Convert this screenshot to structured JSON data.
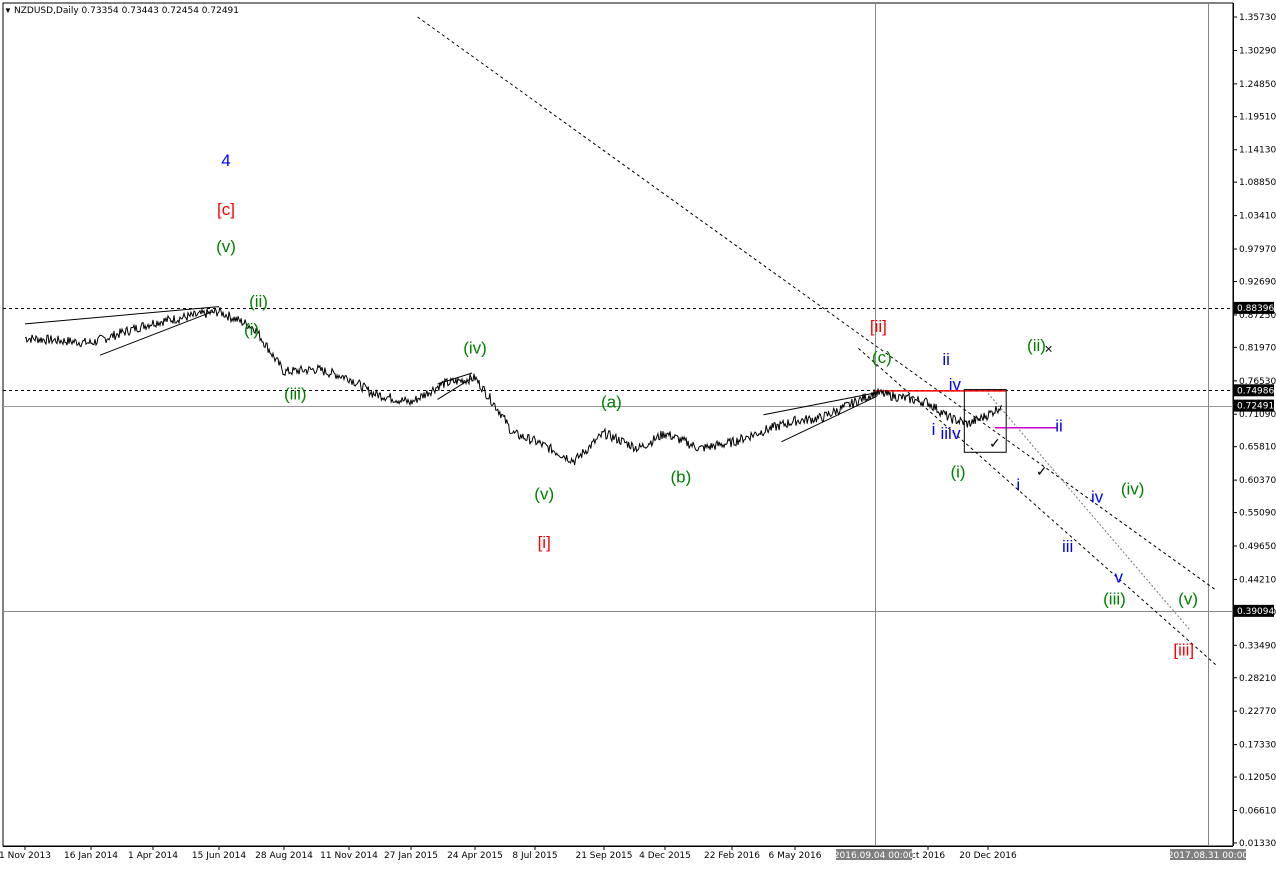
{
  "chart_data": {
    "type": "line",
    "instrument": "NZDUSD,Daily",
    "ohlc": "0.73354 0.73443 0.72454 0.72491",
    "header_text": "NZDUSD,Daily  0.73354 0.73443 0.72454 0.72491",
    "ylim": [
      0.0132,
      1.3573
    ],
    "y_ticks": [
      "1.35730",
      "1.30290",
      "1.24850",
      "1.19510",
      "1.14130",
      "1.08850",
      "1.03410",
      "0.97970",
      "0.92690",
      "0.87250",
      "0.81970",
      "0.76530",
      "0.71090",
      "0.65810",
      "0.60370",
      "0.55090",
      "0.49650",
      "0.44210",
      "0.38930",
      "0.33490",
      "0.28210",
      "0.22770",
      "0.17330",
      "0.12050",
      "0.06610",
      "0.01330"
    ],
    "x_ticks": [
      "1 Nov 2013",
      "16 Jan 2014",
      "1 Apr 2014",
      "15 Jun 2014",
      "28 Aug 2014",
      "11 Nov 2014",
      "27 Jan 2015",
      "24 Apr 2015",
      "8 Jul 2015",
      "21 Sep 2015",
      "4 Dec 2015",
      "22 Feb 2016",
      "6 May 2016",
      "ct 2016",
      "20 Dec 2016"
    ],
    "highlighted_x": [
      "2016.09.04 00:00",
      "2017.08.31 00:00"
    ],
    "price_markers": [
      {
        "label": "0.88396",
        "value": 0.88396,
        "style": "dashed"
      },
      {
        "label": "0.74986",
        "value": 0.74986,
        "style": "dashed"
      },
      {
        "label": "0.72491",
        "value": 0.72491,
        "style": "current"
      },
      {
        "label": "0.39094",
        "value": 0.39094,
        "style": "solid"
      }
    ],
    "series": [
      {
        "values_x": [
          "2013-11-01",
          "2014-01-16",
          "2014-04-01",
          "2014-06-15",
          "2014-07-25",
          "2014-08-28",
          "2014-10-05",
          "2014-11-11",
          "2014-12-10",
          "2015-01-27",
          "2015-03-10",
          "2015-04-24",
          "2015-05-25",
          "2015-06-10",
          "2015-07-08",
          "2015-08-20",
          "2015-09-21",
          "2015-11-02",
          "2015-12-04",
          "2016-01-15",
          "2016-02-22",
          "2016-04-01",
          "2016-05-06",
          "2016-06-15",
          "2016-07-25",
          "2016-09-04",
          "2016-10-05",
          "2016-11-01",
          "2016-11-25",
          "2016-12-20",
          "2017-01-05"
        ],
        "values_y": [
          0.835,
          0.827,
          0.86,
          0.878,
          0.852,
          0.78,
          0.784,
          0.77,
          0.745,
          0.73,
          0.76,
          0.77,
          0.715,
          0.68,
          0.667,
          0.635,
          0.68,
          0.655,
          0.68,
          0.655,
          0.665,
          0.685,
          0.7,
          0.705,
          0.725,
          0.746,
          0.73,
          0.705,
          0.695,
          0.71,
          0.725
        ]
      }
    ],
    "wave_labels": [
      {
        "text": "4",
        "color": "#0000ff",
        "x": "2014-06-23",
        "y": 1.115
      },
      {
        "text": "[c]",
        "color": "#ff0000",
        "x": "2014-06-23",
        "y": 1.035
      },
      {
        "text": "(v)",
        "color": "#008000",
        "x": "2014-06-23",
        "y": 0.975
      },
      {
        "text": "(ii)",
        "color": "#008000",
        "x": "2014-07-30",
        "y": 0.885
      },
      {
        "text": "(i)",
        "color": "#008000",
        "x": "2014-07-22",
        "y": 0.84
      },
      {
        "text": "(iii)",
        "color": "#008000",
        "x": "2014-09-10",
        "y": 0.735
      },
      {
        "text": "(iv)",
        "color": "#008000",
        "x": "2015-04-24",
        "y": 0.81
      },
      {
        "text": "(a)",
        "color": "#008000",
        "x": "2015-09-30",
        "y": 0.722
      },
      {
        "text": "(v)",
        "color": "#008000",
        "x": "2015-07-18",
        "y": 0.572
      },
      {
        "text": "(b)",
        "color": "#008000",
        "x": "2015-12-23",
        "y": 0.6
      },
      {
        "text": "[i]",
        "color": "#ff0000",
        "x": "2015-07-18",
        "y": 0.493
      },
      {
        "text": "[ii]",
        "color": "#ff0000",
        "x": "2016-09-06",
        "y": 0.845
      },
      {
        "text": "(c)",
        "color": "#008000",
        "x": "2016-09-08",
        "y": 0.794
      },
      {
        "text": "ii",
        "color": "#0000ff",
        "x": "2016-10-28",
        "y": 0.791
      },
      {
        "text": "iv",
        "color": "#0000ff",
        "x": "2016-11-08",
        "y": 0.75
      },
      {
        "text": "i",
        "color": "#0000ff",
        "x": "2016-10-12",
        "y": 0.677
      },
      {
        "text": "iii",
        "color": "#0000ff",
        "x": "2016-10-28",
        "y": 0.671
      },
      {
        "text": "v",
        "color": "#0000ff",
        "x": "2016-11-10",
        "y": 0.671
      },
      {
        "text": "(ii)",
        "color": "#008000",
        "x": "2017-02-14",
        "y": 0.814
      },
      {
        "text": "ii",
        "color": "#0000ff",
        "x": "2017-03-12",
        "y": 0.683
      },
      {
        "text": "(i)",
        "color": "#008000",
        "x": "2016-11-12",
        "y": 0.608
      },
      {
        "text": "i",
        "color": "#0000ff",
        "x": "2017-01-24",
        "y": 0.587
      },
      {
        "text": "iv",
        "color": "#0000ff",
        "x": "2017-04-25",
        "y": 0.567
      },
      {
        "text": "(iv)",
        "color": "#008000",
        "x": "2017-06-05",
        "y": 0.58
      },
      {
        "text": "iii",
        "color": "#0000ff",
        "x": "2017-03-22",
        "y": 0.487
      },
      {
        "text": "v",
        "color": "#0000ff",
        "x": "2017-05-20",
        "y": 0.437
      },
      {
        "text": "(iii)",
        "color": "#008000",
        "x": "2017-05-15",
        "y": 0.401
      },
      {
        "text": "(v)",
        "color": "#008000",
        "x": "2017-08-08",
        "y": 0.401
      },
      {
        "text": "[iii]",
        "color": "#ff0000",
        "x": "2017-08-03",
        "y": 0.318
      }
    ],
    "annotation_marks": [
      {
        "symbol": "✓",
        "x": "2016-12-28",
        "y": 0.656
      },
      {
        "symbol": "✓",
        "x": "2017-02-20",
        "y": 0.61
      },
      {
        "symbol": "×",
        "x": "2017-02-28",
        "y": 0.81
      }
    ],
    "trendlines": [
      {
        "style": "dashed",
        "from": {
          "x": "2015-02-05",
          "y": 1.3573
        },
        "to": {
          "x": "2017-09-10",
          "y": 0.424
        }
      },
      {
        "style": "dashed",
        "from": {
          "x": "2016-08-10",
          "y": 0.818
        },
        "to": {
          "x": "2017-09-10",
          "y": 0.302
        }
      },
      {
        "style": "dotted",
        "from": {
          "x": "2016-12-20",
          "y": 0.745
        },
        "to": {
          "x": "2017-08-10",
          "y": 0.36
        }
      },
      {
        "style": "solid",
        "from": {
          "x": "2013-11-01",
          "y": 0.858
        },
        "to": {
          "x": "2014-06-15",
          "y": 0.886
        }
      },
      {
        "style": "solid",
        "from": {
          "x": "2014-01-27",
          "y": 0.807
        },
        "to": {
          "x": "2014-06-08",
          "y": 0.878
        }
      },
      {
        "style": "solid",
        "from": {
          "x": "2016-03-30",
          "y": 0.71
        },
        "to": {
          "x": "2016-09-05",
          "y": 0.746
        }
      },
      {
        "style": "solid",
        "from": {
          "x": "2016-04-20",
          "y": 0.666
        },
        "to": {
          "x": "2016-09-05",
          "y": 0.74
        }
      },
      {
        "style": "solid",
        "from": {
          "x": "2015-03-04",
          "y": 0.76
        },
        "to": {
          "x": "2015-04-20",
          "y": 0.778
        }
      },
      {
        "style": "solid",
        "from": {
          "x": "2015-03-04",
          "y": 0.735
        },
        "to": {
          "x": "2015-04-20",
          "y": 0.77
        }
      }
    ],
    "horizontal_segments": [
      {
        "color": "#ff0000",
        "y": 0.749,
        "from": "2016-09-04",
        "to": "2017-01-10"
      },
      {
        "color": "#cc00cc",
        "y": 0.689,
        "from": "2016-12-28",
        "to": "2017-03-10"
      }
    ],
    "boxes": [
      {
        "from": {
          "x": "2016-11-20",
          "y": 0.751
        },
        "to": {
          "x": "2017-01-10",
          "y": 0.649
        }
      }
    ],
    "vlines": [
      "2016-09-04",
      "2017-08-31"
    ],
    "colors": {
      "background": "#ffffff",
      "price": "#000000",
      "grid": "#808080",
      "wave_green": "#008000",
      "wave_blue": "#0000ff",
      "wave_red": "#ff0000",
      "marker_bg": "#000000",
      "marker_fg": "#ffffff",
      "axis_highlight_bg": "#808080"
    }
  }
}
